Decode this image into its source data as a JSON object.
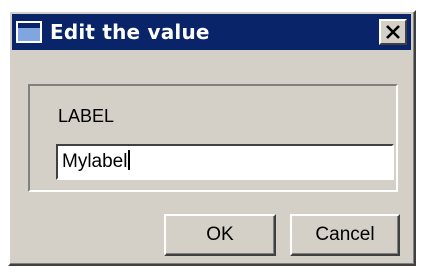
{
  "window": {
    "title": "Edit the value",
    "icons": {
      "app": "window-icon",
      "close": "close-icon"
    }
  },
  "form": {
    "label": "LABEL",
    "value": "Mylabel"
  },
  "buttons": {
    "ok_label": "OK",
    "cancel_label": "Cancel"
  },
  "colors": {
    "titlebar": "#0a246a",
    "face": "#d4d0c8"
  }
}
